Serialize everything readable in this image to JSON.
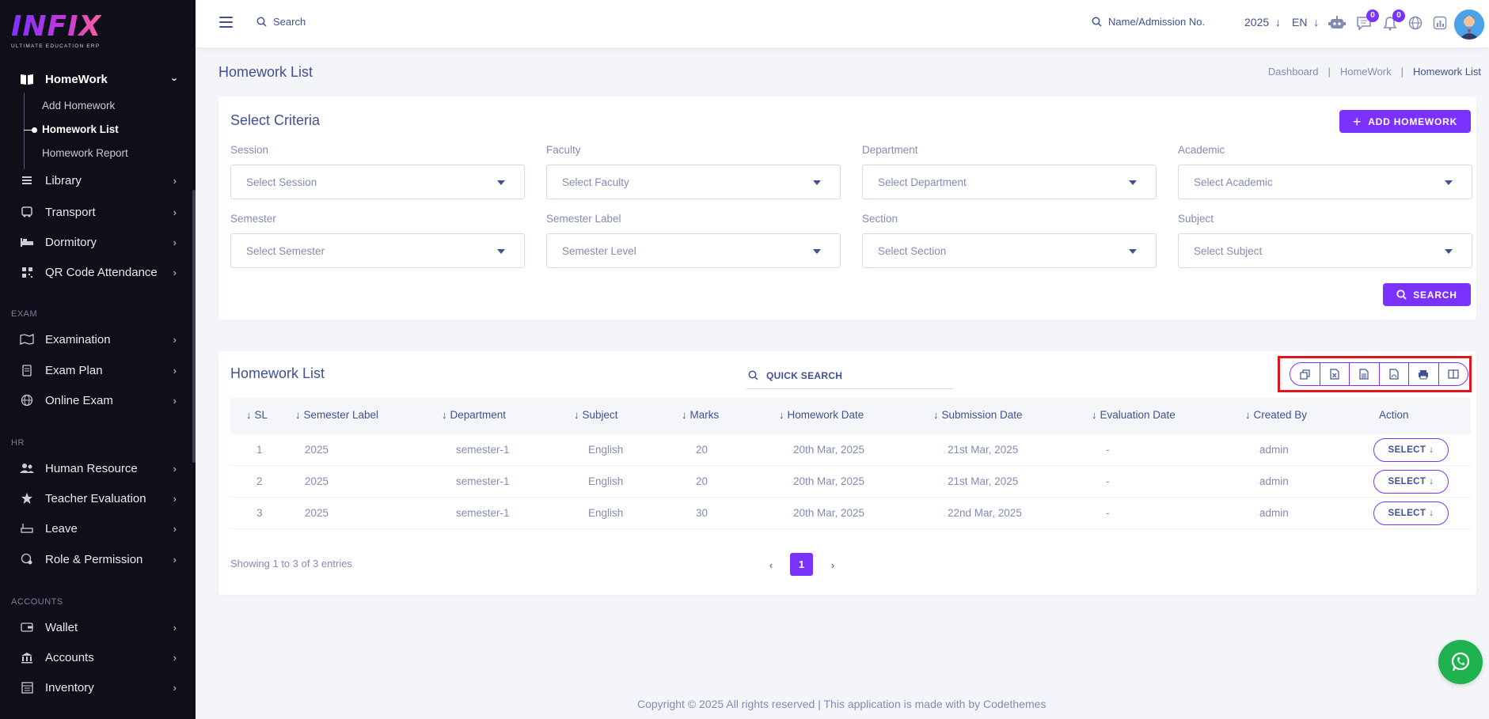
{
  "brand": {
    "logo_text": "INFIX",
    "tagline": "ULTIMATE EDUCATION ERP"
  },
  "sidebar": {
    "homework": {
      "label": "HomeWork",
      "sub": [
        "Add Homework",
        "Homework List",
        "Homework Report"
      ]
    },
    "items": [
      {
        "label": "Library",
        "icon": "library-icon"
      },
      {
        "label": "Transport",
        "icon": "bus-icon"
      },
      {
        "label": "Dormitory",
        "icon": "bed-icon"
      },
      {
        "label": "QR Code Attendance",
        "icon": "qr-icon"
      },
      {
        "label": "Examination",
        "icon": "map-icon"
      },
      {
        "label": "Exam Plan",
        "icon": "clipboard-icon"
      },
      {
        "label": "Online Exam",
        "icon": "globe-icon"
      },
      {
        "label": "Human Resource",
        "icon": "users-icon"
      },
      {
        "label": "Teacher Evaluation",
        "icon": "star-icon"
      },
      {
        "label": "Leave",
        "icon": "leave-icon"
      },
      {
        "label": "Role & Permission",
        "icon": "role-icon"
      },
      {
        "label": "Wallet",
        "icon": "wallet-icon"
      },
      {
        "label": "Accounts",
        "icon": "bank-icon"
      },
      {
        "label": "Inventory",
        "icon": "inventory-icon"
      }
    ],
    "sections": {
      "exam": "EXAM",
      "hr": "HR",
      "accounts": "ACCOUNTS"
    }
  },
  "topbar": {
    "search_label": "Search",
    "name_search_label": "Name/Admission No.",
    "year": "2025",
    "lang": "EN",
    "messages_count": "0",
    "notifications_count": "0"
  },
  "page": {
    "title": "Homework List",
    "breadcrumb": [
      "Dashboard",
      "HomeWork",
      "Homework List"
    ]
  },
  "criteria": {
    "title": "Select Criteria",
    "add_button": "ADD HOMEWORK",
    "search_button": "SEARCH",
    "fields": [
      {
        "label": "Session",
        "placeholder": "Select Session"
      },
      {
        "label": "Faculty",
        "placeholder": "Select Faculty"
      },
      {
        "label": "Department",
        "placeholder": "Select Department"
      },
      {
        "label": "Academic",
        "placeholder": "Select Academic"
      },
      {
        "label": "Semester",
        "placeholder": "Select Semester"
      },
      {
        "label": "Semester Label",
        "placeholder": "Semester Level"
      },
      {
        "label": "Section",
        "placeholder": "Select Section"
      },
      {
        "label": "Subject",
        "placeholder": "Select Subject"
      }
    ]
  },
  "list": {
    "title": "Homework List",
    "quick_search": "QUICK SEARCH",
    "export_buttons": [
      "copy-icon",
      "excel-icon",
      "csv-icon",
      "pdf-icon",
      "print-icon",
      "columns-icon"
    ],
    "headers": [
      "SL",
      "Semester Label",
      "Department",
      "Subject",
      "Marks",
      "Homework Date",
      "Submission Date",
      "Evaluation Date",
      "Created By",
      "Action"
    ],
    "rows": [
      {
        "sl": "1",
        "semester_label": "2025",
        "department": "semester-1",
        "subject": "English",
        "marks": "20",
        "homework_date": "20th Mar, 2025",
        "submission_date": "21st Mar, 2025",
        "evaluation_date": "-",
        "created_by": "admin",
        "action": "SELECT"
      },
      {
        "sl": "2",
        "semester_label": "2025",
        "department": "semester-1",
        "subject": "English",
        "marks": "20",
        "homework_date": "20th Mar, 2025",
        "submission_date": "21st Mar, 2025",
        "evaluation_date": "-",
        "created_by": "admin",
        "action": "SELECT"
      },
      {
        "sl": "3",
        "semester_label": "2025",
        "department": "semester-1",
        "subject": "English",
        "marks": "30",
        "homework_date": "20th Mar, 2025",
        "submission_date": "22nd Mar, 2025",
        "evaluation_date": "-",
        "created_by": "admin",
        "action": "SELECT"
      }
    ],
    "showing": "Showing 1 to 3 of 3 entries",
    "current_page": "1"
  },
  "footer": {
    "text": "Copyright © 2025 All rights reserved | This application is made with by Codethemes"
  },
  "colors": {
    "accent": "#7c32ff",
    "sidebar_bg": "#0f0f1a",
    "text": "#415094",
    "muted": "#828bb2",
    "highlight": "#e2141e",
    "whatsapp": "#1fb350"
  }
}
